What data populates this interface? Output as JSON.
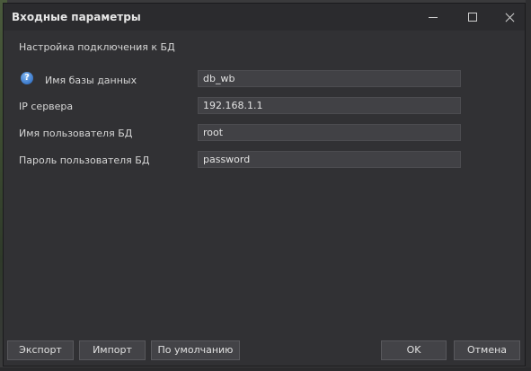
{
  "window": {
    "title": "Входные параметры"
  },
  "section": {
    "title": "Настройка подключения к БД"
  },
  "fields": [
    {
      "label": "Имя базы данных",
      "value": "db_wb"
    },
    {
      "label": "IP сервера",
      "value": "192.168.1.1"
    },
    {
      "label": "Имя пользователя БД",
      "value": "root"
    },
    {
      "label": "Пароль пользователя БД",
      "value": "password"
    }
  ],
  "help_icon": {
    "glyph": "?",
    "icon": "question-mark-icon",
    "color": "#3a78c9"
  },
  "buttons": {
    "export": "Экспорт",
    "import": "Импорт",
    "default": "По умолчанию",
    "ok": "OK",
    "cancel": "Отмена"
  }
}
